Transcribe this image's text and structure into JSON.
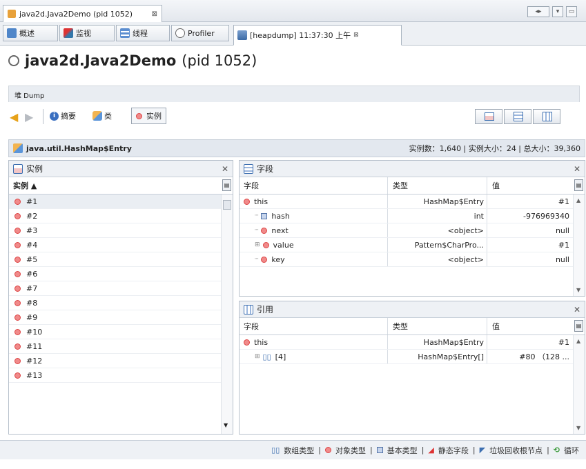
{
  "window_tab": {
    "label": "java2d.Java2Demo (pid 1052)",
    "close": "⊠"
  },
  "subtabs": {
    "overview": "概述",
    "monitor": "监视",
    "threads": "线程",
    "profiler": "Profiler",
    "heapdump": "[heapdump] 11:37:30 上午",
    "heapdump_close": "⊠"
  },
  "app": {
    "name": "java2d.Java2Demo",
    "pid": "(pid 1052)"
  },
  "dump_label": "堆 Dump",
  "toolbar": {
    "summary": "摘要",
    "classes": "类",
    "instances": "实例"
  },
  "class_bar": {
    "class_name": "java.util.HashMap$Entry",
    "stats": "实例数：1,640 | 实例大小：24 | 总大小：39,360"
  },
  "instances_panel": {
    "title": "实例",
    "column": "实例 ▲",
    "rows": [
      "#1",
      "#2",
      "#3",
      "#4",
      "#5",
      "#6",
      "#7",
      "#8",
      "#9",
      "#10",
      "#11",
      "#12",
      "#13"
    ]
  },
  "fields_panel": {
    "title": "字段",
    "columns": {
      "field": "字段",
      "type": "类型",
      "value": "值"
    },
    "rows": [
      {
        "field": "this",
        "type": "HashMap$Entry",
        "value": "#1",
        "kind": "object"
      },
      {
        "field": "hash",
        "type": "int",
        "value": "-976969340",
        "kind": "primitive"
      },
      {
        "field": "next",
        "type": "<object>",
        "value": "null",
        "kind": "object"
      },
      {
        "field": "value",
        "type": "Pattern$CharPro...",
        "value": "#1",
        "kind": "object"
      },
      {
        "field": "key",
        "type": "<object>",
        "value": "null",
        "kind": "object"
      }
    ]
  },
  "refs_panel": {
    "title": "引用",
    "columns": {
      "field": "字段",
      "type": "类型",
      "value": "值"
    },
    "rows": [
      {
        "field": "this",
        "type": "HashMap$Entry",
        "value": "#1",
        "kind": "object"
      },
      {
        "field": "[4]",
        "type": "HashMap$Entry[]",
        "value": "#80 （128 ...",
        "kind": "array"
      }
    ]
  },
  "legend": {
    "array": "数组类型",
    "object": "对象类型",
    "primitive": "基本类型",
    "static": "静态字段",
    "gc_root": "垃圾回收根节点",
    "loop": "循环"
  },
  "colors": {
    "object_dot": "#f08a8a",
    "accent": "#5474a8"
  }
}
